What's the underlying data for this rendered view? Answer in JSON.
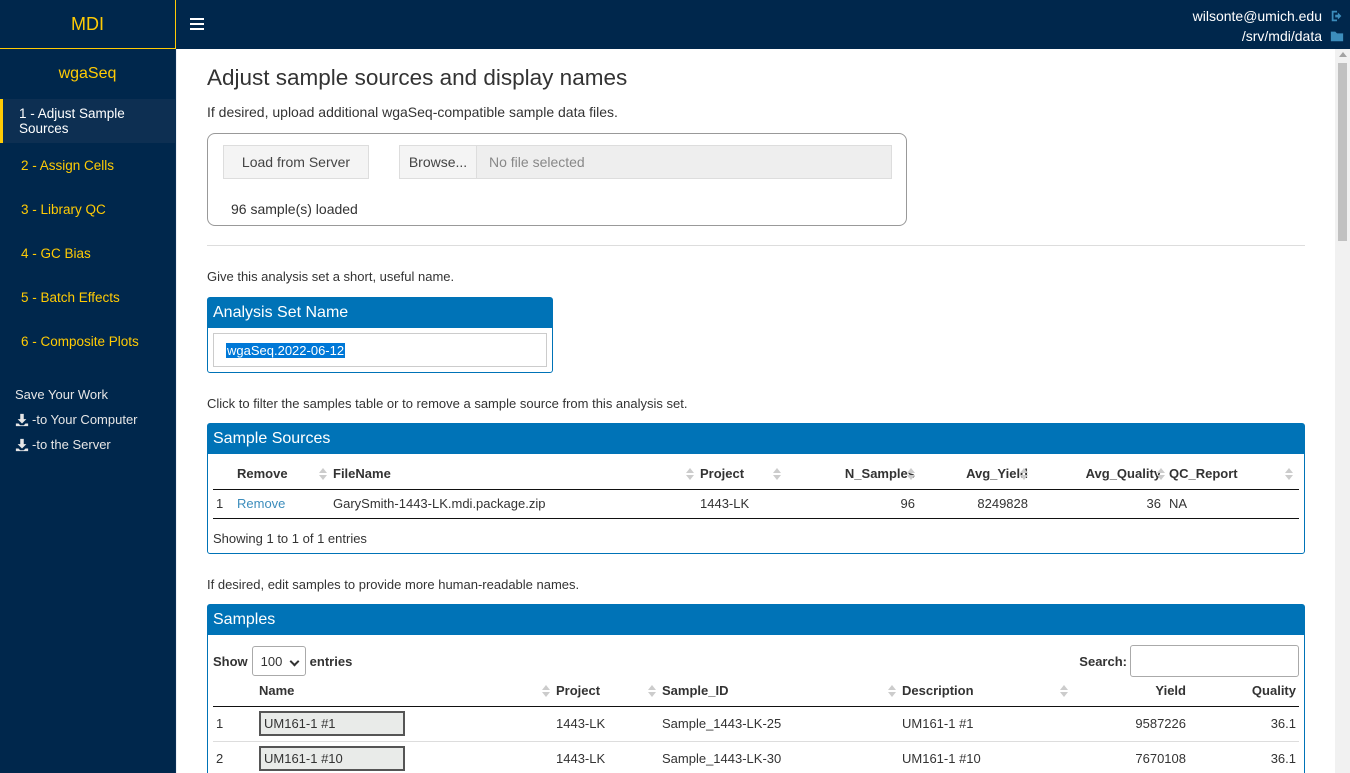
{
  "header": {
    "logo": "MDI",
    "user_email": "wilsonte@umich.edu",
    "data_dir": "/srv/mdi/data"
  },
  "sidebar": {
    "app_name": "wgaSeq",
    "items": [
      {
        "label": "1 - Adjust Sample Sources"
      },
      {
        "label": "2 - Assign Cells"
      },
      {
        "label": "3 - Library QC"
      },
      {
        "label": "4 - GC Bias"
      },
      {
        "label": "5 - Batch Effects"
      },
      {
        "label": "6 - Composite Plots"
      }
    ],
    "save_title": "Save Your Work",
    "save_computer": "-to Your Computer",
    "save_server": "-to the Server"
  },
  "main": {
    "title": "Adjust sample sources and display names",
    "subtitle": "If desired, upload additional wgaSeq-compatible sample data files.",
    "load_button": "Load from Server",
    "browse_button": "Browse...",
    "file_placeholder": "No file selected",
    "loaded_text": "96 sample(s) loaded",
    "name_hint": "Give this analysis set a short, useful name.",
    "analysis_set_title": "Analysis Set Name",
    "analysis_set_value": "wgaSeq.2022-06-12",
    "sources_hint": "Click to filter the samples table or to remove a sample source from this analysis set.",
    "samples_hint": "If desired, edit samples to provide more human-readable names."
  },
  "sources_table": {
    "title": "Sample Sources",
    "columns": [
      "",
      "Remove",
      "FileName",
      "Project",
      "N_Samples",
      "Avg_Yield",
      "Avg_Quality",
      "QC_Report"
    ],
    "rows": [
      {
        "idx": "1",
        "remove": "Remove",
        "filename": "GarySmith-1443-LK.mdi.package.zip",
        "project": "1443-LK",
        "n_samples": "96",
        "avg_yield": "8249828",
        "avg_quality": "36",
        "qc_report": "NA"
      }
    ],
    "footer": "Showing 1 to 1 of 1 entries"
  },
  "samples_table": {
    "title": "Samples",
    "show_label": "Show",
    "entries_value": "100",
    "entries_label": "entries",
    "search_label": "Search:",
    "columns": [
      "",
      "Name",
      "Project",
      "Sample_ID",
      "Description",
      "Yield",
      "Quality"
    ],
    "rows": [
      {
        "idx": "1",
        "name": "UM161-1 #1",
        "project": "1443-LK",
        "sample_id": "Sample_1443-LK-25",
        "description": "UM161-1 #1",
        "yield": "9587226",
        "quality": "36.1"
      },
      {
        "idx": "2",
        "name": "UM161-1 #10",
        "project": "1443-LK",
        "sample_id": "Sample_1443-LK-30",
        "description": "UM161-1 #10",
        "yield": "7670108",
        "quality": "36.1"
      }
    ]
  },
  "colors": {
    "header_bg": "#00274c",
    "accent": "#ffcb05",
    "panel": "#0073b7"
  }
}
